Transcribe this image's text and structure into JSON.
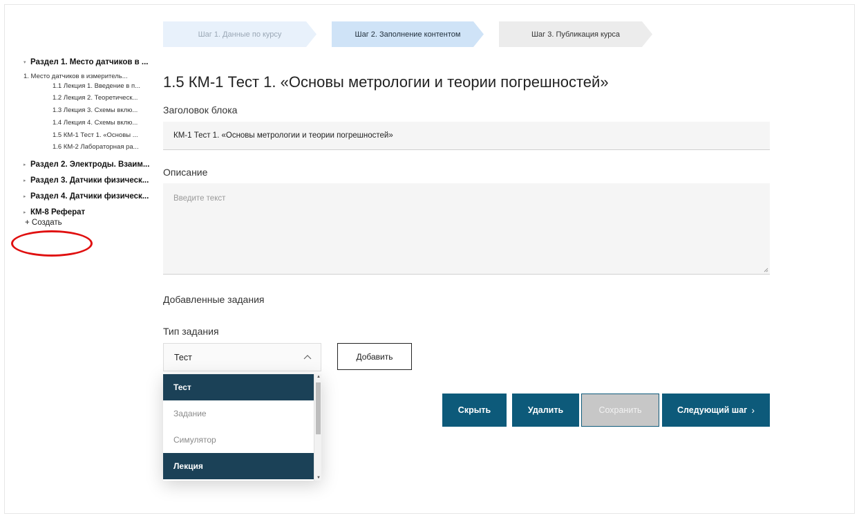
{
  "stepper": {
    "step1": "Шаг 1. Данные по курсу",
    "step2": "Шаг 2. Заполнение контентом",
    "step3": "Шаг 3. Публикация курса"
  },
  "sidebar": {
    "sections": [
      "Раздел 1. Место датчиков в ...",
      "Раздел 2. Электроды. Взаим...",
      "Раздел 3. Датчики физическ...",
      "Раздел 4. Датчики физическ...",
      "КМ-8 Реферат"
    ],
    "subsection": "1. Место датчиков в измеритель...",
    "lessons": [
      "1.1 Лекция 1. Введение в п...",
      "1.2 Лекция 2. Теоретическ...",
      "1.3 Лекция 3. Схемы вклю...",
      "1.4 Лекция 4. Схемы вклю...",
      "1.5 КМ-1 Тест 1. «Основы ...",
      "1.6 КМ-2 Лабораторная ра..."
    ],
    "create": "+ Создать"
  },
  "main": {
    "title": "1.5 КМ-1 Тест 1. «Основы метрологии и теории погрешностей»",
    "block_title_label": "Заголовок блока",
    "block_title_value": "КМ-1 Тест 1. «Основы метрологии и теории погрешностей»",
    "description_label": "Описание",
    "description_placeholder": "Введите текст",
    "added_tasks_label": "Добавленные задания",
    "task_type_label": "Тип задания",
    "task_type_selected": "Тест",
    "add_button": "Добавить",
    "dropdown_options": [
      "Тест",
      "Задание",
      "Симулятор",
      "Лекция"
    ]
  },
  "actions": {
    "hide": "Скрыть",
    "delete": "Удалить",
    "save": "Сохранить",
    "next": "Следующий шаг"
  },
  "colors": {
    "primary": "#0d5a7a",
    "option_selected": "#1b4157",
    "annotation": "#e01010"
  }
}
